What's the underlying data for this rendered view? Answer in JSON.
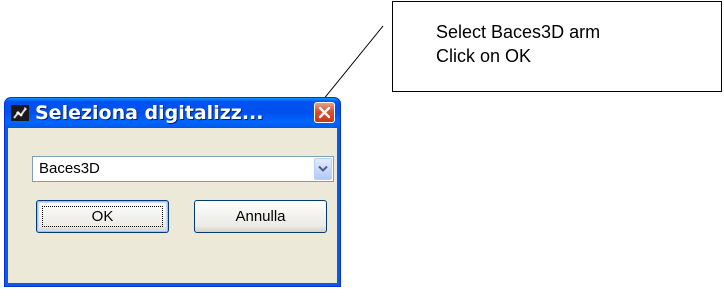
{
  "annotation": {
    "line1": "Select Baces3D arm",
    "line2": "Click on  OK"
  },
  "dialog": {
    "title": "Seleziona digitalizz...",
    "app_icon": "digitizer-arm-icon",
    "close_icon": "close-icon",
    "combo": {
      "value": "Baces3D",
      "arrow_icon": "chevron-down-icon"
    },
    "buttons": {
      "ok_label": "OK",
      "cancel_label": "Annulla"
    }
  },
  "colors": {
    "titlebar": "#0053ee",
    "window_border": "#0831d9",
    "client_bg": "#ece9d8",
    "close_button": "#d8512f",
    "input_border": "#7f9db9"
  }
}
